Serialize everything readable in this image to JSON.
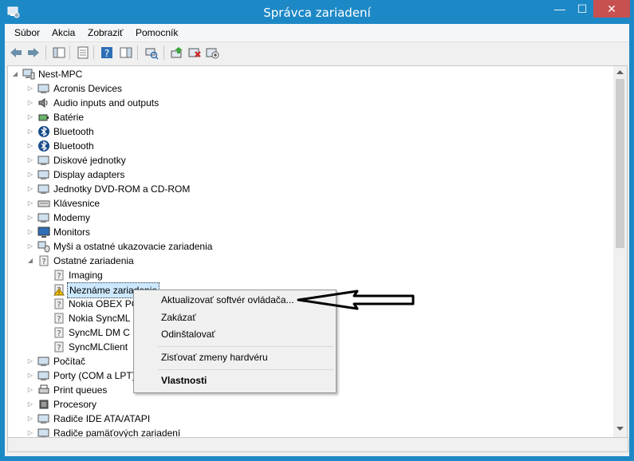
{
  "window": {
    "title": "Správca zariadení",
    "controls": {
      "minimize": "—",
      "maximize": "☐",
      "close": "✕"
    }
  },
  "menubar": {
    "items": [
      "Súbor",
      "Akcia",
      "Zobraziť",
      "Pomocník"
    ]
  },
  "toolbar": {
    "icons": [
      "back-arrow-icon",
      "forward-arrow-icon",
      "show-hide-console-tree-icon",
      "properties-icon",
      "help-icon",
      "show-action-pane-icon",
      "scan-hardware-icon",
      "update-driver-icon",
      "uninstall-icon",
      "disable-icon"
    ]
  },
  "tree": {
    "root": "Nest-MPC",
    "categories": [
      {
        "label": "Acronis Devices",
        "icon": "device-icon",
        "expanded": false
      },
      {
        "label": "Audio inputs and outputs",
        "icon": "speaker-icon",
        "expanded": false
      },
      {
        "label": "Batérie",
        "icon": "battery-icon",
        "expanded": false
      },
      {
        "label": "Bluetooth",
        "icon": "bluetooth-icon",
        "expanded": false
      },
      {
        "label": "Bluetooth",
        "icon": "bluetooth-icon",
        "expanded": false
      },
      {
        "label": "Diskové jednotky",
        "icon": "disk-icon",
        "expanded": false
      },
      {
        "label": "Display adapters",
        "icon": "display-adapter-icon",
        "expanded": false
      },
      {
        "label": "Jednotky DVD-ROM a CD-ROM",
        "icon": "dvd-icon",
        "expanded": false
      },
      {
        "label": "Klávesnice",
        "icon": "keyboard-icon",
        "expanded": false
      },
      {
        "label": "Modemy",
        "icon": "modem-icon",
        "expanded": false
      },
      {
        "label": "Monitors",
        "icon": "monitor-icon",
        "expanded": false
      },
      {
        "label": "Myši a ostatné ukazovacie zariadenia",
        "icon": "mouse-icon",
        "expanded": false
      },
      {
        "label": "Ostatné zariadenia",
        "icon": "unknown-device-icon",
        "expanded": true
      }
    ],
    "other_devices": [
      {
        "label": "Imaging",
        "warning": false
      },
      {
        "label": "Neznáme zariadenie",
        "warning": true,
        "selected": true
      },
      {
        "label": "Nokia OBEX PC",
        "warning": false
      },
      {
        "label": "Nokia SyncML",
        "warning": false
      },
      {
        "label": "SyncML DM C",
        "warning": false
      },
      {
        "label": "SyncMLClient",
        "warning": false
      }
    ],
    "more_categories": [
      {
        "label": "Počítač",
        "icon": "computer-icon"
      },
      {
        "label": "Porty (COM a LPT)",
        "icon": "port-icon"
      },
      {
        "label": "Print queues",
        "icon": "printer-icon"
      },
      {
        "label": "Procesory",
        "icon": "processor-icon"
      },
      {
        "label": "Radiče IDE ATA/ATAPI",
        "icon": "ide-controller-icon"
      },
      {
        "label": "Radiče pamäťových zariadení",
        "icon": "storage-controller-icon"
      }
    ]
  },
  "context_menu": {
    "update": "Aktualizovať softvér ovládača...",
    "disable": "Zakázať",
    "uninstall": "Odinštalovať",
    "scan": "Zisťovať zmeny hardvéru",
    "properties": "Vlastnosti"
  },
  "colors": {
    "titlebar": "#1d88c6",
    "close_button": "#c75050",
    "selection": "#cce8ff",
    "warning": "#f5c400"
  }
}
